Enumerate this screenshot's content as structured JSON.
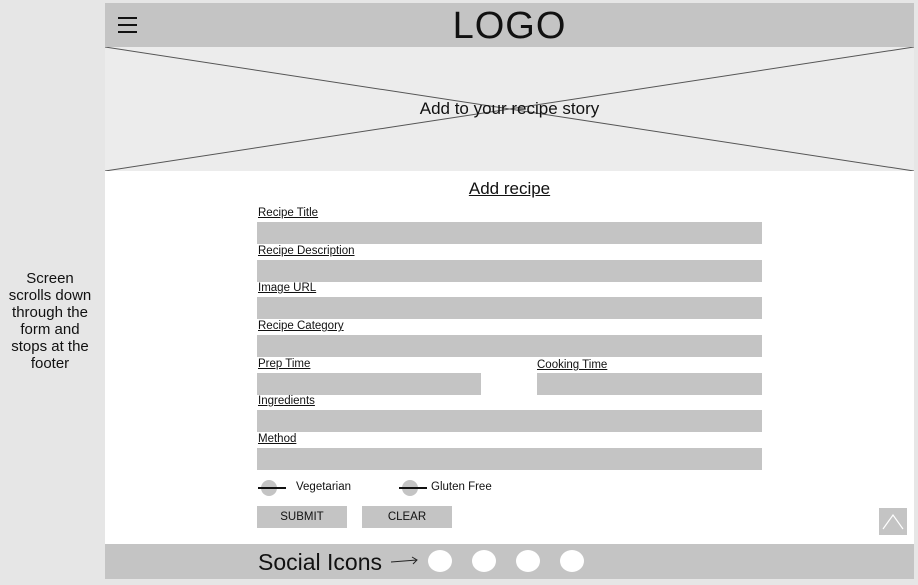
{
  "side_note": "Screen\nscrolls down\nthrough the\nform and\nstops at the\nfooter",
  "header": {
    "logo": "LOGO",
    "menu_icon": "hamburger-menu-icon"
  },
  "hero": {
    "text": "Add to your recipe story"
  },
  "form": {
    "title": "Add recipe",
    "fields": {
      "recipe_title": "Recipe Title",
      "recipe_description": "Recipe Description",
      "image_url": "Image URL",
      "recipe_category": "Recipe Category",
      "prep_time": "Prep Time",
      "cooking_time": "Cooking Time",
      "ingredients": "Ingredients",
      "method": "Method"
    },
    "toggles": {
      "vegetarian": "Vegetarian",
      "gluten_free": "Gluten Free"
    },
    "buttons": {
      "submit": "SUBMIT",
      "clear": "CLEAR"
    }
  },
  "footer": {
    "social_label": "Social Icons",
    "social_icon_count": 4
  },
  "colors": {
    "placeholder_gray": "#c4c4c4",
    "background": "#e6e6e6",
    "hero": "#ececec"
  }
}
